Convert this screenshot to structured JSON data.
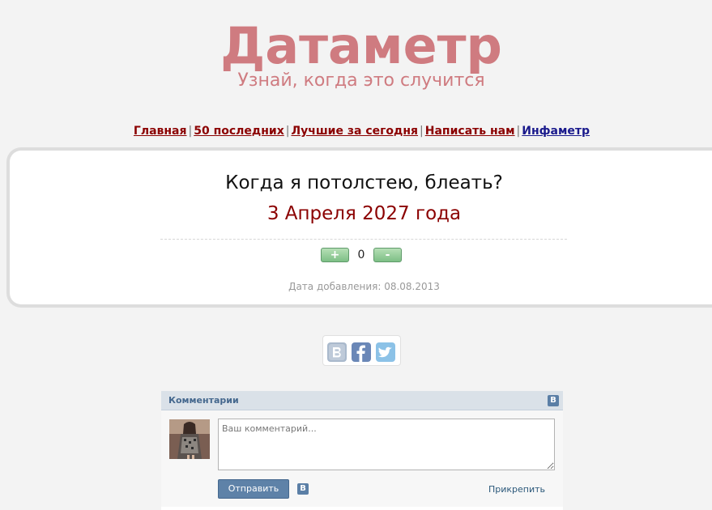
{
  "site": {
    "logo": "Датаметр",
    "tagline": "Узнай, когда это случится"
  },
  "nav": {
    "items": [
      {
        "label": "Главная"
      },
      {
        "label": "50 последних"
      },
      {
        "label": "Лучшие за сегодня"
      },
      {
        "label": "Написать нам"
      },
      {
        "label": "Инфаметр"
      }
    ],
    "separator": "|"
  },
  "prediction": {
    "question": "Когда я потолстею, блеать?",
    "answer": "3 Апреля 2027 года",
    "vote_plus": "+",
    "vote_minus": "-",
    "score": "0",
    "date_added": "Дата добавления: 08.08.2013"
  },
  "share": {
    "icons": [
      "vk-icon",
      "facebook-icon",
      "twitter-icon"
    ]
  },
  "comments": {
    "title": "Комментарии",
    "vk_badge": "В",
    "placeholder": "Ваш комментарий...",
    "send_label": "Отправить",
    "attach_label": "Прикрепить"
  },
  "colors": {
    "brand": "#cf7b80",
    "link_red": "#8b0000",
    "link_blue": "#1a1a8c",
    "vk_blue": "#5e82a8"
  }
}
